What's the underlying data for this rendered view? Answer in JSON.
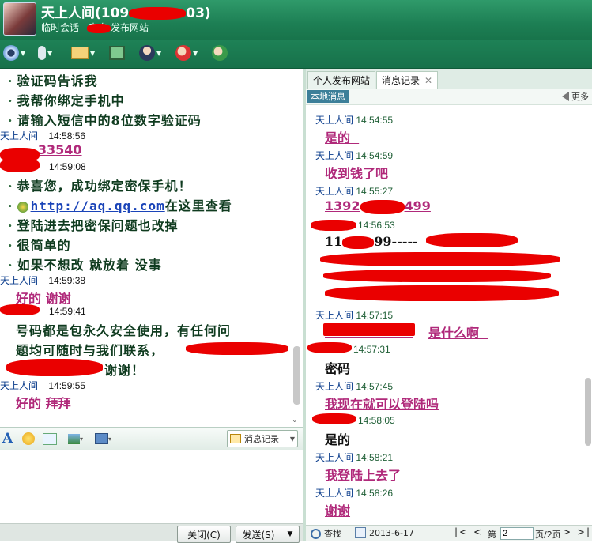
{
  "window": {
    "title_prefix": "天上人间(109",
    "title_suffix": "03)",
    "subtitle_prefix": "临时会话 - 来自",
    "subtitle_suffix": "发布网站"
  },
  "toolbar": {
    "icons": [
      "video-call-icon",
      "voice-call-icon",
      "send-file-icon",
      "remote-desktop-icon",
      "contacts-icon",
      "block-user-icon",
      "add-friend-icon"
    ]
  },
  "left_chat": {
    "lines": [
      {
        "type": "bullet",
        "text": "验证码告诉我"
      },
      {
        "type": "bullet",
        "text": "我帮你绑定手机中"
      },
      {
        "type": "bullet",
        "text": "请输入短信中的8位数字验证码"
      },
      {
        "type": "meta",
        "name": "天上人间",
        "time": "14:58:56"
      },
      {
        "type": "pink",
        "text": "33540"
      },
      {
        "type": "meta_self",
        "time": "14:59:08"
      },
      {
        "type": "bullet",
        "text": "恭喜您，成功绑定密保手机！"
      },
      {
        "type": "link",
        "url": "http://aq.qq.com",
        "after": "在这里查看"
      },
      {
        "type": "plain",
        "text": "登陆进去把密保问题也改掉"
      },
      {
        "type": "bullet",
        "text": "很简单的"
      },
      {
        "type": "bullet",
        "text": "如果不想改  就放着  没事"
      },
      {
        "type": "meta",
        "name": "天上人间",
        "time": "14:59:38"
      },
      {
        "type": "pink",
        "text": "好的  谢谢"
      },
      {
        "type": "meta_self",
        "time": "14:59:41"
      },
      {
        "type": "plain",
        "text": "号码都是包永久安全使用，有任何问"
      },
      {
        "type": "plain",
        "text": "题均可随时与我们联系，"
      },
      {
        "type": "plain",
        "text": "谢谢！"
      },
      {
        "type": "meta",
        "name": "天上人间",
        "time": "14:59:55"
      },
      {
        "type": "pink",
        "text": "好的   拜拜"
      }
    ]
  },
  "input_toolbar": {
    "history_label": "消息记录"
  },
  "bottom_buttons": {
    "close": "关闭(C)",
    "send": "发送(S)"
  },
  "right_panel": {
    "tabs": [
      {
        "label": "个人发布网站",
        "active": false
      },
      {
        "label": "消息记录",
        "active": true
      }
    ],
    "local_tag": "本地消息",
    "more_label": "更多",
    "entries": [
      {
        "meta": "天上人间",
        "time": "14:54:55",
        "msg": "是的",
        "style": "pink"
      },
      {
        "meta": "天上人间",
        "time": "14:54:59",
        "msg": "收到钱了吧",
        "style": "pink"
      },
      {
        "meta": "天上人间",
        "time": "14:55:27",
        "msg_prefix": "1392",
        "msg_suffix": "499",
        "style": "pink"
      },
      {
        "meta_self": true,
        "time": "14:56:53",
        "msg_prefix": "11",
        "msg_suffix": "99-----",
        "style": "black"
      },
      {
        "meta": "天上人间",
        "time": "14:57:15",
        "msg": "是什么啊",
        "style": "pink"
      },
      {
        "meta_self": true,
        "time": "14:57:31",
        "msg": "密码",
        "style": "black"
      },
      {
        "meta": "天上人间",
        "time": "14:57:45",
        "msg": "我现在就可以登陆吗",
        "style": "pink"
      },
      {
        "meta_self": true,
        "time": "14:58:05",
        "msg": "是的",
        "style": "black"
      },
      {
        "meta": "天上人间",
        "time": "14:58:21",
        "msg": "我登陆上去了",
        "style": "pink"
      },
      {
        "meta": "天上人间",
        "time": "14:58:26",
        "msg": "谢谢",
        "style": "pink"
      }
    ],
    "footer": {
      "search_label": "查找",
      "date": "2013-6-17",
      "page_prefix": "第",
      "page_value": "2",
      "page_suffix": "页/2页"
    }
  },
  "colors": {
    "titlebar": "#1d7f54",
    "pink_text": "#b0297a",
    "green_text": "#0f3b1f",
    "redaction": "#ea0000"
  }
}
